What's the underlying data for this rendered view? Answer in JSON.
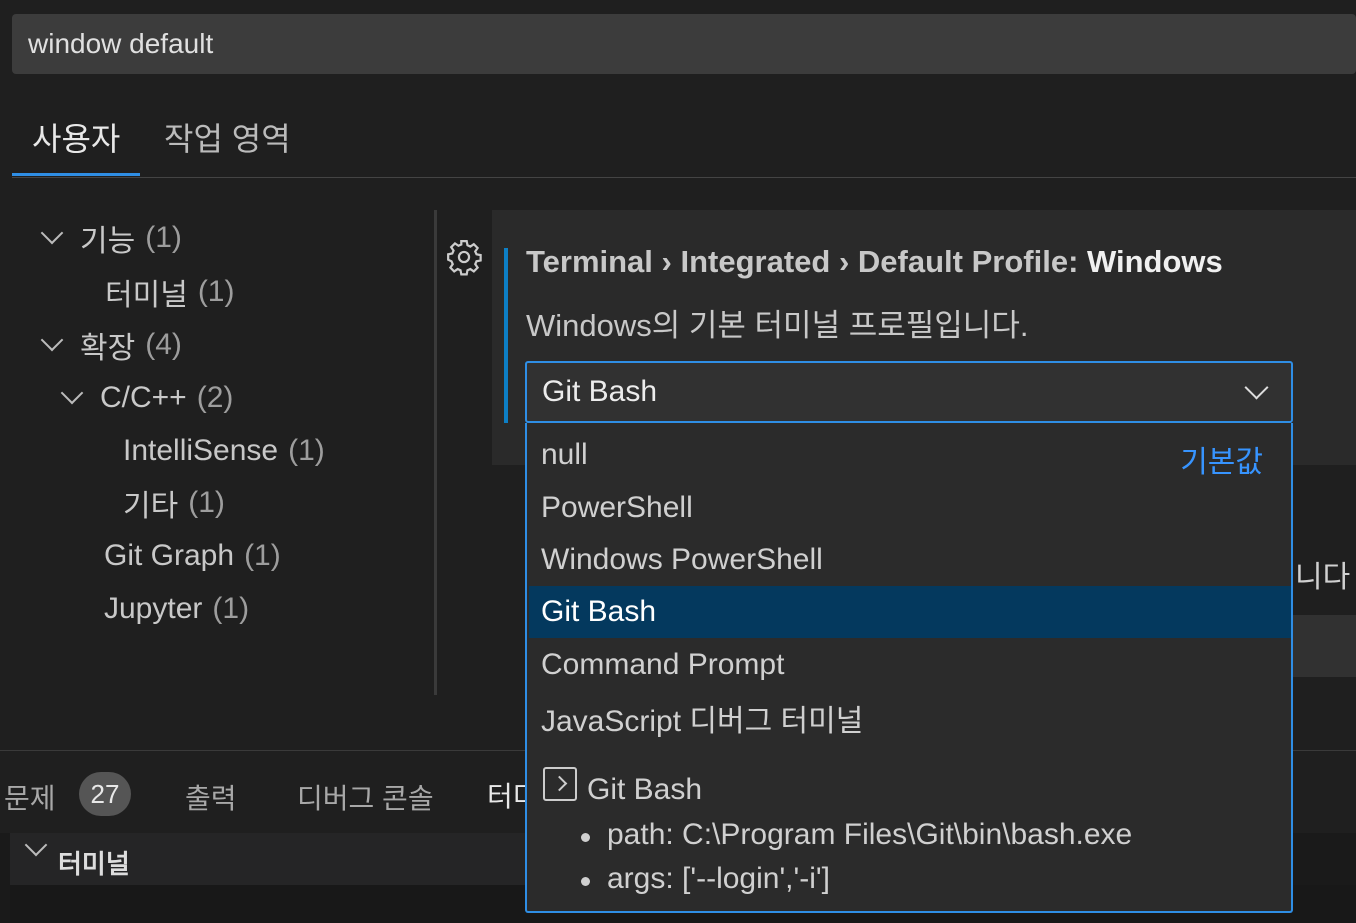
{
  "search": {
    "value": "window default"
  },
  "scope_tabs": [
    {
      "label": "사용자",
      "active": true
    },
    {
      "label": "작업 영역",
      "active": false
    }
  ],
  "toc": [
    {
      "label": "기능",
      "count": "(1)",
      "expanded": true
    },
    {
      "label": "터미널",
      "count": "(1)"
    },
    {
      "label": "확장",
      "count": "(4)",
      "expanded": true
    },
    {
      "label": "C/C++",
      "count": "(2)",
      "expanded": true
    },
    {
      "label": "IntelliSense",
      "count": "(1)"
    },
    {
      "label": "기타",
      "count": "(1)"
    },
    {
      "label": "Git Graph",
      "count": "(1)"
    },
    {
      "label": "Jupyter",
      "count": "(1)"
    }
  ],
  "setting": {
    "breadcrumb_1": "Terminal",
    "breadcrumb_2": "Integrated",
    "breadcrumb_3": "Default Profile:",
    "name": "Windows",
    "separator": "›",
    "description": "Windows의 기본 터미널 프로필입니다.",
    "selected_value": "Git Bash",
    "gear_icon": "gear-icon"
  },
  "dropdown": {
    "options": [
      {
        "label": "null",
        "tag": "기본값"
      },
      {
        "label": "PowerShell"
      },
      {
        "label": "Windows PowerShell"
      },
      {
        "label": "Git Bash",
        "selected": true
      },
      {
        "label": "Command Prompt"
      },
      {
        "label": "JavaScript 디버그 터미널"
      }
    ],
    "detail": {
      "title": "Git Bash",
      "path": "path: C:\\Program Files\\Git\\bin\\bash.exe",
      "args": "args: ['--login','-i']"
    }
  },
  "background": {
    "partial_text": "니다"
  },
  "panel": {
    "tabs": [
      {
        "label": "문제",
        "badge": "27"
      },
      {
        "label": "출력"
      },
      {
        "label": "디버그 콘솔"
      },
      {
        "label": "터미널",
        "active": true
      }
    ],
    "terminal_section": "터미널"
  },
  "colors": {
    "accent": "#2f8ee5",
    "selection": "#04395e",
    "default_tag": "#3794ff"
  }
}
